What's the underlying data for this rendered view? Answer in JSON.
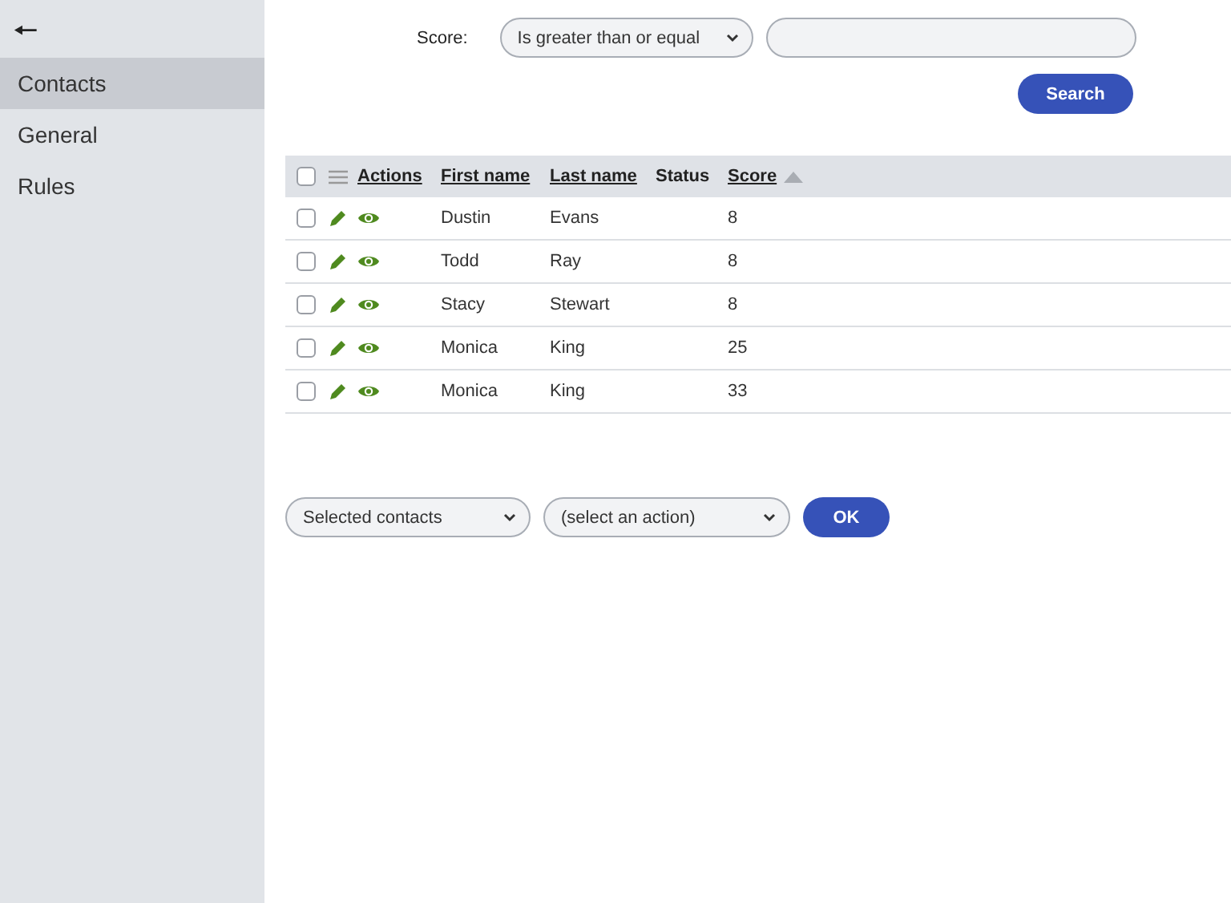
{
  "sidebar": {
    "back": "🠔",
    "items": [
      {
        "label": "Contacts",
        "selected": true
      },
      {
        "label": "General",
        "selected": false
      },
      {
        "label": "Rules",
        "selected": false
      }
    ]
  },
  "filter": {
    "label": "Score:",
    "operator": "Is greater than or equal",
    "search_button": "Search"
  },
  "table": {
    "select_all_checked": false,
    "columns": [
      {
        "label": "Actions",
        "sortable": true,
        "sorted": false
      },
      {
        "label": "First name",
        "sortable": true,
        "sorted": false
      },
      {
        "label": "Last name",
        "sortable": true,
        "sorted": false
      },
      {
        "label": "Status",
        "sortable": false,
        "sorted": false
      },
      {
        "label": "Score",
        "sortable": true,
        "sorted": true
      }
    ],
    "rows": [
      {
        "checked": false,
        "first_name": "Dustin",
        "last_name": "Evans",
        "score": "8"
      },
      {
        "checked": false,
        "first_name": "Todd",
        "last_name": "Ray",
        "score": "8"
      },
      {
        "checked": false,
        "first_name": "Stacy",
        "last_name": "Stewart",
        "score": "8"
      },
      {
        "checked": false,
        "first_name": "Monica",
        "last_name": "King",
        "score": "25"
      },
      {
        "checked": false,
        "first_name": "Monica",
        "last_name": "King",
        "score": "33"
      }
    ]
  },
  "bulk": {
    "target": "Selected contacts",
    "action": "(select an action)",
    "ok_button": "OK"
  }
}
